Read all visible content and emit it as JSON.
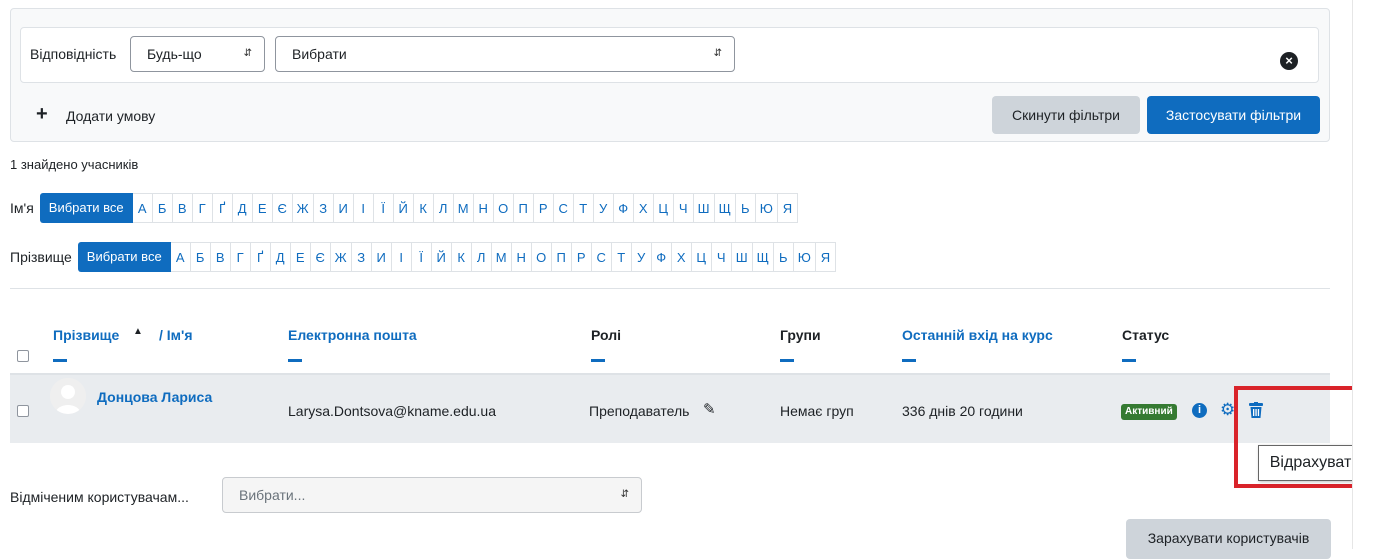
{
  "filters": {
    "match_label": "Відповідність",
    "match_value": "Будь-що",
    "type_value": "Вибрати",
    "add_condition": "Додати умову",
    "reset_button": "Скинути фільтри",
    "apply_button": "Застосувати фільтри"
  },
  "participants_count": "1 знайдено учасників",
  "firstname_bar": {
    "caption": "Ім'я",
    "all": "Вибрати все",
    "letters": [
      "А",
      "Б",
      "В",
      "Г",
      "Ґ",
      "Д",
      "Е",
      "Є",
      "Ж",
      "З",
      "И",
      "І",
      "Ї",
      "Й",
      "К",
      "Л",
      "М",
      "Н",
      "О",
      "П",
      "Р",
      "С",
      "Т",
      "У",
      "Ф",
      "Х",
      "Ц",
      "Ч",
      "Ш",
      "Щ",
      "Ь",
      "Ю",
      "Я"
    ]
  },
  "lastname_bar": {
    "caption": "Прізвище",
    "all": "Вибрати все",
    "letters": [
      "А",
      "Б",
      "В",
      "Г",
      "Ґ",
      "Д",
      "Е",
      "Є",
      "Ж",
      "З",
      "И",
      "І",
      "Ї",
      "Й",
      "К",
      "Л",
      "М",
      "Н",
      "О",
      "П",
      "Р",
      "С",
      "Т",
      "У",
      "Ф",
      "Х",
      "Ц",
      "Ч",
      "Ш",
      "Щ",
      "Ь",
      "Ю",
      "Я"
    ]
  },
  "table": {
    "headers": {
      "lastname": "Прізвище",
      "sep_firstname": "/ Ім'я",
      "email": "Електронна пошта",
      "roles": "Ролі",
      "groups": "Групи",
      "last_access": "Останній вхід на курс",
      "status": "Статус"
    },
    "row": {
      "name": "Донцова Лариса",
      "email": "Larysa.Dontsova@kname.edu.ua",
      "role": "Преподаватель",
      "groups": "Немає груп",
      "last_access": "336 днів 20 години",
      "status": "Активний"
    }
  },
  "bulk": {
    "label": "Відміченим користувачам...",
    "select_placeholder": "Вибрати...",
    "enrol_button": "Зарахувати користувачів"
  },
  "tooltip": "Відрахувати",
  "icons": {
    "close": "close-circle-icon",
    "plus": "plus-icon",
    "sort": "sort-up-icon",
    "edit": "pencil-icon",
    "info": "info-icon",
    "settings": "cog-icon",
    "delete": "trash-icon",
    "avatar": "user-avatar-icon"
  },
  "colors": {
    "primary": "#0f6cbf",
    "active_badge": "#357a32",
    "highlight": "#d9232a"
  }
}
